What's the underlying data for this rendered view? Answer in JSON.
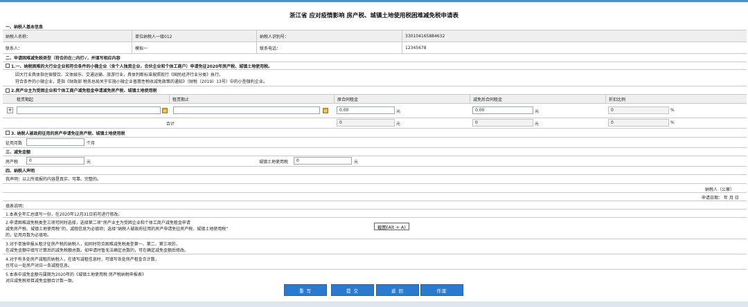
{
  "form": {
    "title": "浙江省 应对疫情影响 房产税、城镇土地使用税困难减免税申请表"
  },
  "section1": {
    "heading": "一、纳税人基本信息",
    "taxpayer_name_label": "纳税人名称：",
    "taxpayer_name_value": "单位纳税人一级012",
    "taxpayer_id_label": "纳税人识别号：",
    "taxpayer_id_value": "330104165884632",
    "contact_label": "联系人：",
    "contact_value": "模拟一",
    "phone_label": "联系电话：",
    "phone_value": "12345678"
  },
  "section2": {
    "heading": "二、申请困难减免税类型（符合的在□内打√，并填写相应内容",
    "option1_label": "1.一、纳税困难的大行业企业和符合条件的小微企业（含个人独资企业、合伙企业和个体工商户）申请免征2020年房产税、城镇土地使用税。",
    "option1_note1": "因大行业具体指住宿餐饮、文体娱乐、交通运输、旅游行业，具体判断标准按照现行《国民经济行业分类》执行。",
    "option1_note2": "符合条件的小微企业，是指《财政部 税务总局关于实施小微企业普惠性税收减免政策的通知》（财税〔2019〕13号）中的小型微利企业。",
    "option2_label": "2.房产业主为受困企业和个体工商户减免租金申请减免房产税、城镇土地使用税",
    "col_lease_start": "租赁期起",
    "col_lease_end": "租赁期止",
    "col_rent_before": "原合同租金",
    "col_rent_after": "减免后合同租金",
    "col_discount": "折扣比例",
    "add_label": "+",
    "rent_before_value": "0.00",
    "rent_after_value": "0.00",
    "discount_value": "0",
    "unit_yuan": "元",
    "unit_percent": "%",
    "total_label": "合计",
    "total_before": "0",
    "total_after": "0",
    "total_discount": "0",
    "option3_label": "3. 纳税人被政府征用的房产申请免征房产税、城镇土地使用税",
    "requisition_label": "征用月数",
    "requisition_unit": "个月"
  },
  "section3": {
    "heading": "三、减免金额",
    "property_tax_label": "房产税",
    "property_tax_value": "0",
    "land_tax_label": "城镇土地使用税",
    "land_tax_value": "0",
    "unit_yuan": "元"
  },
  "section4": {
    "heading": "四、纳税人声明",
    "declaration": "我声明：以上所填报的内容是真实、可靠、完整的。",
    "signature_label": "纳税人（公章）",
    "date_label": "申请日期： 年 月 日"
  },
  "notes": {
    "heading": "填表说明：",
    "n1": "1.本表全年汇总填写一份，在2020年12月31日前可进行修改。",
    "n2a": "2.申请困难减免税类型三项可同时选择，选择第二项“房产业主为受困企业和个体工商户减免租金申请",
    "n2b": "减免房产税、城镇土地使用税”的，减租信息为必填项；选择“纳税人被政府征用的房产申请免征房产税、城镇土地使用税”",
    "n2c": "的，征用月数为必填项。",
    "n3a": "3.对于单独申报从租计征房产税的纳税人，如同时符合困难减免税类型第一、第二、第三项的，",
    "n3b": "在减免金额中填写计算后的减免税额总数。如申请时暂无法确定总数的，可在确定减免金额后修改。",
    "n4a": "4.对于有多处房产减租的纳税人，在填写减租信息时，可填写各处房产租金合计数，",
    "n4b": "也可以一处房产对应一条减租信息。",
    "n5a": "5.本表中减免金额与属期为2020年的《城镇土地使用税 房产税纳税申报表》",
    "n5b": "对应减免税项目减免金额合计数一致。"
  },
  "tooltip": {
    "text": "截图(Alt + A)"
  },
  "buttons": {
    "reset": "重 写",
    "submit": "提 交",
    "back": "返 回",
    "void": "作废"
  },
  "colors": {
    "accent": "#2a7bd0",
    "topbar": "#4c8fd6",
    "calendar": "#e2a23b"
  }
}
